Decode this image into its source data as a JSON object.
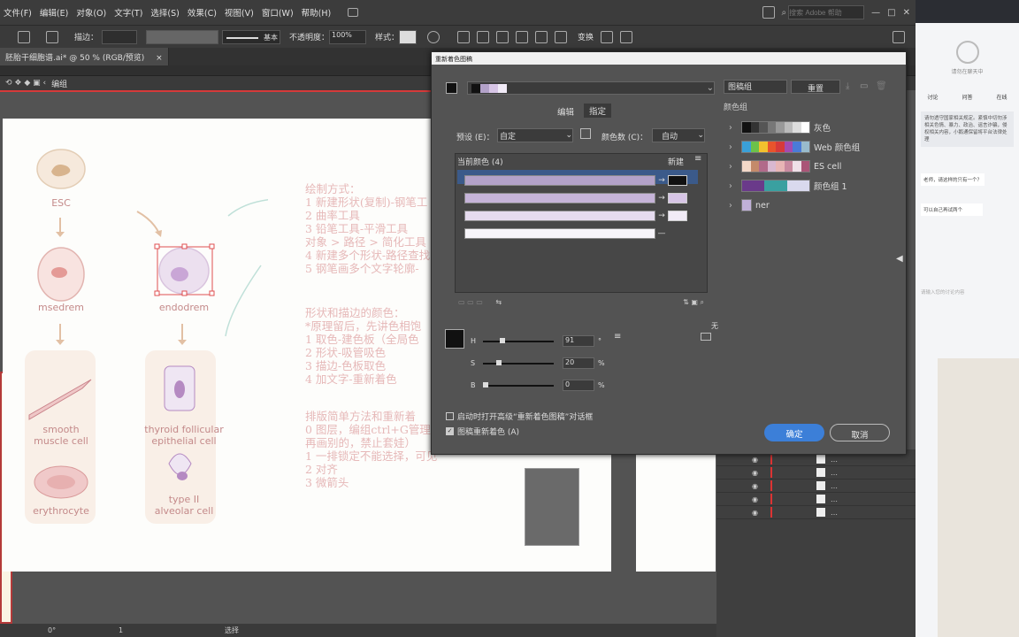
{
  "menu": {
    "file": "文件(F)",
    "edit": "编辑(E)",
    "object": "对象(O)",
    "text": "文字(T)",
    "select": "选择(S)",
    "effect": "效果(C)",
    "view": "视图(V)",
    "window": "窗口(W)",
    "help": "帮助(H)"
  },
  "search": {
    "placeholder": "搜索 Adobe 帮助"
  },
  "controlbar": {
    "stroke_label": "描边：",
    "basic": "基本",
    "opacity_label": "不透明度：",
    "opacity_value": "100%",
    "style_label": "样式：",
    "transform": "变换"
  },
  "doc_tab": {
    "title": "胚胎干细胞谱.ai* @ 50 % (RGB/预览)",
    "close": "×"
  },
  "breadcrumb": {
    "group": "编组"
  },
  "cells": [
    {
      "label": "ESC"
    },
    {
      "label": "msedrem"
    },
    {
      "label": "endodrem"
    },
    {
      "label": "smooth\nmuscle cell"
    },
    {
      "label": "thyroid follicular\nepithelial cell"
    },
    {
      "label": "erythrocyte"
    },
    {
      "label": "type II\nalveolar cell"
    }
  ],
  "notes": {
    "block1": [
      "绘制方式：",
      "1 新建形状(复制)-钢笔工",
      "2 曲率工具",
      "3 铅笔工具-平滑工具",
      "对象 > 路径 > 简化工具",
      "4 新建多个形状-路径查找",
      "5 钢笔画多个文字轮廓-"
    ],
    "block2": [
      "形状和描边的颜色：",
      "*原理留后，先讲色相饱",
      "1 取色-建色板（全局色",
      "2 形状-吸管吸色",
      "3 描边-色板取色",
      "4 加文字-重新着色"
    ],
    "block3": [
      "排版简单方法和重新着",
      "0 图层，编组ctrl+G管理",
      "再画别的，禁止套娃）",
      "1 一排锁定不能选择，可见",
      "2 对齐",
      "3 微箭头"
    ]
  },
  "dialog": {
    "title": "重新着色图稿",
    "group_field": "图稿组",
    "reset": "重置",
    "tab_edit": "编辑",
    "tab_assign": "指定",
    "preset_label": "预设 (E)：",
    "preset_value": "自定",
    "colors_label": "颜色数 (C)：",
    "colors_value": "自动",
    "current_colors": "当前颜色 (4)",
    "new_label": "新建",
    "hsb": [
      {
        "k": "H",
        "v": "91",
        "u": "°",
        "pos": 0.25
      },
      {
        "k": "S",
        "v": "20",
        "u": "%",
        "pos": 0.2
      },
      {
        "k": "B",
        "v": "0",
        "u": "%",
        "pos": 0.0
      }
    ],
    "none_label": "无",
    "cb_advanced": "启动时打开高级“重新着色图稿”对话框",
    "cb_recolor": "图稿重新着色 (A)",
    "ok": "确定",
    "cancel": "取消",
    "color_groups_title": "颜色组",
    "groups": [
      {
        "name": "灰色",
        "colors": [
          "#111",
          "#333",
          "#555",
          "#777",
          "#999",
          "#bbb",
          "#ddd",
          "#fff"
        ]
      },
      {
        "name": "Web 颜色组",
        "colors": [
          "#3aa0d8",
          "#6cc24a",
          "#f2c12e",
          "#e8542c",
          "#d63a3a",
          "#a34bb0",
          "#4a7bd8",
          "#9bc"
        ]
      },
      {
        "name": "ES cell",
        "colors": [
          "#f3d9c9",
          "#c48a6a",
          "#b16a8a",
          "#d9b8d0",
          "#e8b5b5",
          "#c98aa0",
          "#efe0e8",
          "#aa5577"
        ]
      },
      {
        "name": "颜色组 1",
        "colors": [
          "#6a3a8a",
          "#3aa0a0",
          "#d9d9ee"
        ]
      },
      {
        "name": "ner",
        "colors": [
          "#c0b0d8"
        ]
      }
    ],
    "rows": [
      {
        "cur": "#b3a2c9",
        "new": "#111111"
      },
      {
        "cur": "#c6b4d9",
        "new": "#d7c5e6"
      },
      {
        "cur": "#e6dbef",
        "new": "#f1ebf7"
      },
      {
        "cur": "#f6f4f9",
        "new": null
      }
    ]
  },
  "statusbar": {
    "zoom": "0°",
    "page": "1",
    "mode": "选择"
  },
  "right_panel": {
    "tab1": "讨论",
    "tab2": "问答",
    "tab3": "在线",
    "title": "请勿在聊天中",
    "notice": "请勿透守国家相关规定。紧慎中切勿涉相关色情、暴力、政治、谣言诈骗，侵权相关内容，小鹅通保留将平台法律处理",
    "msg1": "老师，请这样的只有一个？",
    "msg2": "可以自己再试两个",
    "input": "请输入您的讨论内容"
  }
}
